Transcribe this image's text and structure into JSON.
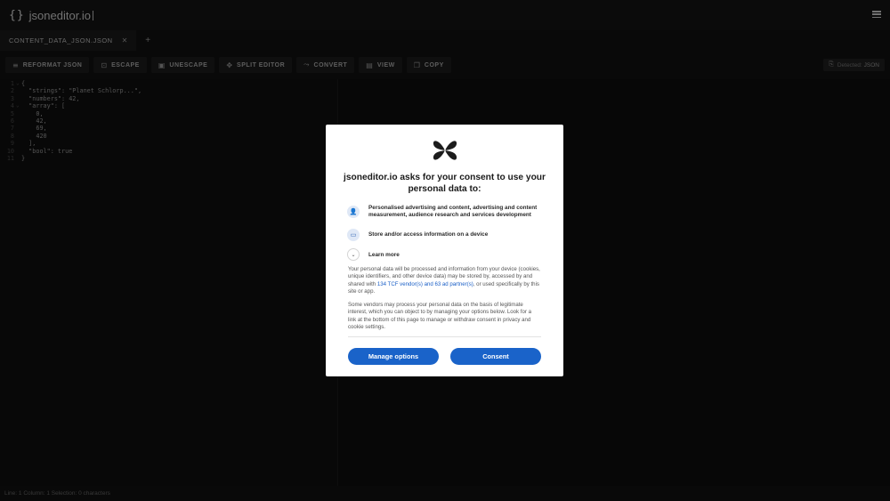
{
  "app": {
    "braces": "{}",
    "name": "jsoneditor.io"
  },
  "tabs": [
    {
      "label": "CONTENT_DATA_JSON.JSON",
      "close": "✕"
    }
  ],
  "tab_add": "+",
  "toolbar": {
    "buttons": [
      {
        "label": "REFORMAT JSON",
        "icon": "align-left-icon"
      },
      {
        "label": "ESCAPE",
        "icon": "lock-open-icon"
      },
      {
        "label": "UNESCAPE",
        "icon": "lock-icon"
      },
      {
        "label": "SPLIT EDITOR",
        "icon": "split-icon"
      },
      {
        "label": "CONVERT",
        "icon": "convert-icon"
      },
      {
        "label": "VIEW",
        "icon": "view-icon"
      },
      {
        "label": "COPY",
        "icon": "copy-icon"
      }
    ],
    "detected_label": "Detected:",
    "detected_lang": "JSON"
  },
  "editor": {
    "lines": [
      {
        "n": "1",
        "fold": "⌄",
        "text": "{"
      },
      {
        "n": "2",
        "fold": "",
        "text": "  \"strings\": \"Planet Schlorp...\","
      },
      {
        "n": "3",
        "fold": "",
        "text": "  \"numbers\": 42,"
      },
      {
        "n": "4",
        "fold": "⌄",
        "text": "  \"array\": ["
      },
      {
        "n": "5",
        "fold": "",
        "text": "    0,"
      },
      {
        "n": "6",
        "fold": "",
        "text": "    42,"
      },
      {
        "n": "7",
        "fold": "",
        "text": "    69,"
      },
      {
        "n": "8",
        "fold": "",
        "text": "    420"
      },
      {
        "n": "9",
        "fold": "",
        "text": "  ],"
      },
      {
        "n": "10",
        "fold": "",
        "text": "  \"bool\": true"
      },
      {
        "n": "11",
        "fold": "",
        "text": "}"
      }
    ]
  },
  "status": "Line: 1 Column: 1 Selection: 0 characters",
  "consent": {
    "title": "jsoneditor.io asks for your consent to use your personal data to:",
    "purposes": [
      {
        "icon": "person-icon",
        "text": "Personalised advertising and content, advertising and content measurement, audience research and services development"
      },
      {
        "icon": "device-icon",
        "text": "Store and/or access information on a device"
      }
    ],
    "learn_more": "Learn more",
    "para1_a": "Your personal data will be processed and information from your device (cookies, unique identifiers, and other device data) may be stored by, accessed by and shared with ",
    "para1_link": "134 TCF vendor(s) and 63 ad partner(s)",
    "para1_b": ", or used specifically by this site or app.",
    "para2": "Some vendors may process your personal data on the basis of legitimate interest, which you can object to by managing your options below. Look for a link at the bottom of this page to manage or withdraw consent in privacy and cookie settings.",
    "manage_label": "Manage options",
    "consent_label": "Consent",
    "button_color": "#1a63c9"
  }
}
